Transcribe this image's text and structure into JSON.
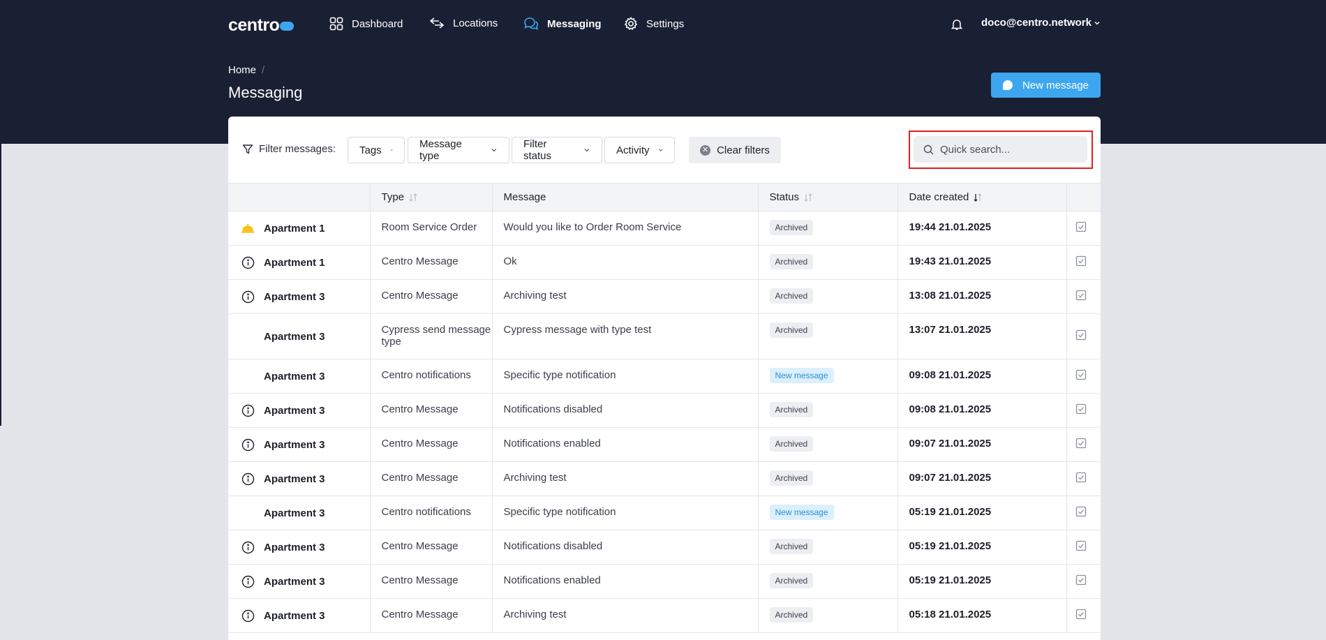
{
  "nav": {
    "logo": "centro",
    "items": [
      {
        "label": "Dashboard",
        "icon": "grid-icon"
      },
      {
        "label": "Locations",
        "icon": "arrows-icon"
      },
      {
        "label": "Messaging",
        "icon": "chat-bubbles-icon"
      },
      {
        "label": "Settings",
        "icon": "gear-icon"
      }
    ],
    "user": "doco@centro.network"
  },
  "breadcrumb": {
    "home": "Home",
    "separator": "/"
  },
  "page": {
    "title": "Messaging",
    "new_message": "New message"
  },
  "filters": {
    "label": "Filter messages:",
    "tags": "Tags",
    "message_type": "Message type",
    "filter_status": "Filter status",
    "activity": "Activity",
    "clear": "Clear filters",
    "search_placeholder": "Quick search..."
  },
  "table": {
    "headers": {
      "type": "Type",
      "message": "Message",
      "status": "Status",
      "date": "Date created"
    },
    "rows": [
      {
        "icon": "bell-service-icon",
        "location": "Apartment 1",
        "type": "Room Service Order",
        "message": "Would you like to Order Room Service",
        "status": "Archived",
        "date": "19:44 21.01.2025"
      },
      {
        "icon": "info-icon",
        "location": "Apartment 1",
        "type": "Centro Message",
        "message": "Ok",
        "status": "Archived",
        "date": "19:43 21.01.2025"
      },
      {
        "icon": "info-icon",
        "location": "Apartment 3",
        "type": "Centro Message",
        "message": "Archiving test",
        "status": "Archived",
        "date": "13:08 21.01.2025"
      },
      {
        "icon": "",
        "location": "Apartment 3",
        "type": "Cypress send message type",
        "message": "Cypress message with type test",
        "status": "Archived",
        "date": "13:07 21.01.2025"
      },
      {
        "icon": "",
        "location": "Apartment 3",
        "type": "Centro notifications",
        "message": "Specific type notification",
        "status": "New message",
        "date": "09:08 21.01.2025"
      },
      {
        "icon": "info-icon",
        "location": "Apartment 3",
        "type": "Centro Message",
        "message": "Notifications disabled",
        "status": "Archived",
        "date": "09:08 21.01.2025"
      },
      {
        "icon": "info-icon",
        "location": "Apartment 3",
        "type": "Centro Message",
        "message": "Notifications enabled",
        "status": "Archived",
        "date": "09:07 21.01.2025"
      },
      {
        "icon": "info-icon",
        "location": "Apartment 3",
        "type": "Centro Message",
        "message": "Archiving test",
        "status": "Archived",
        "date": "09:07 21.01.2025"
      },
      {
        "icon": "",
        "location": "Apartment 3",
        "type": "Centro notifications",
        "message": "Specific type notification",
        "status": "New message",
        "date": "05:19 21.01.2025"
      },
      {
        "icon": "info-icon",
        "location": "Apartment 3",
        "type": "Centro Message",
        "message": "Notifications disabled",
        "status": "Archived",
        "date": "05:19 21.01.2025"
      },
      {
        "icon": "info-icon",
        "location": "Apartment 3",
        "type": "Centro Message",
        "message": "Notifications enabled",
        "status": "Archived",
        "date": "05:19 21.01.2025"
      },
      {
        "icon": "info-icon",
        "location": "Apartment 3",
        "type": "Centro Message",
        "message": "Archiving test",
        "status": "Archived",
        "date": "05:18 21.01.2025"
      }
    ]
  },
  "colors": {
    "topbar": "#1a2034",
    "accent": "#3ea6ee",
    "highlight": "#e02020"
  }
}
